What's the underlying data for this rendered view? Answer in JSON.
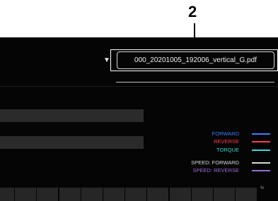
{
  "callout": {
    "number": "2"
  },
  "file": {
    "name": "000_20201005_192006_vertical_G.pdf"
  },
  "icons": {
    "dropdown": "▼"
  },
  "legend": [
    {
      "label": "FORWARD",
      "color": "#3d7cff"
    },
    {
      "label": "REVERSE",
      "color": "#ff3b52"
    },
    {
      "label": "TORQUE",
      "color": "#3fd6d6"
    },
    {
      "label": "SPEED: FORWARD",
      "color": "#d9d9d9"
    },
    {
      "label": "SPEED: REVERSE",
      "color": "#9b6bd8"
    }
  ],
  "grid": {
    "unit": "%"
  }
}
